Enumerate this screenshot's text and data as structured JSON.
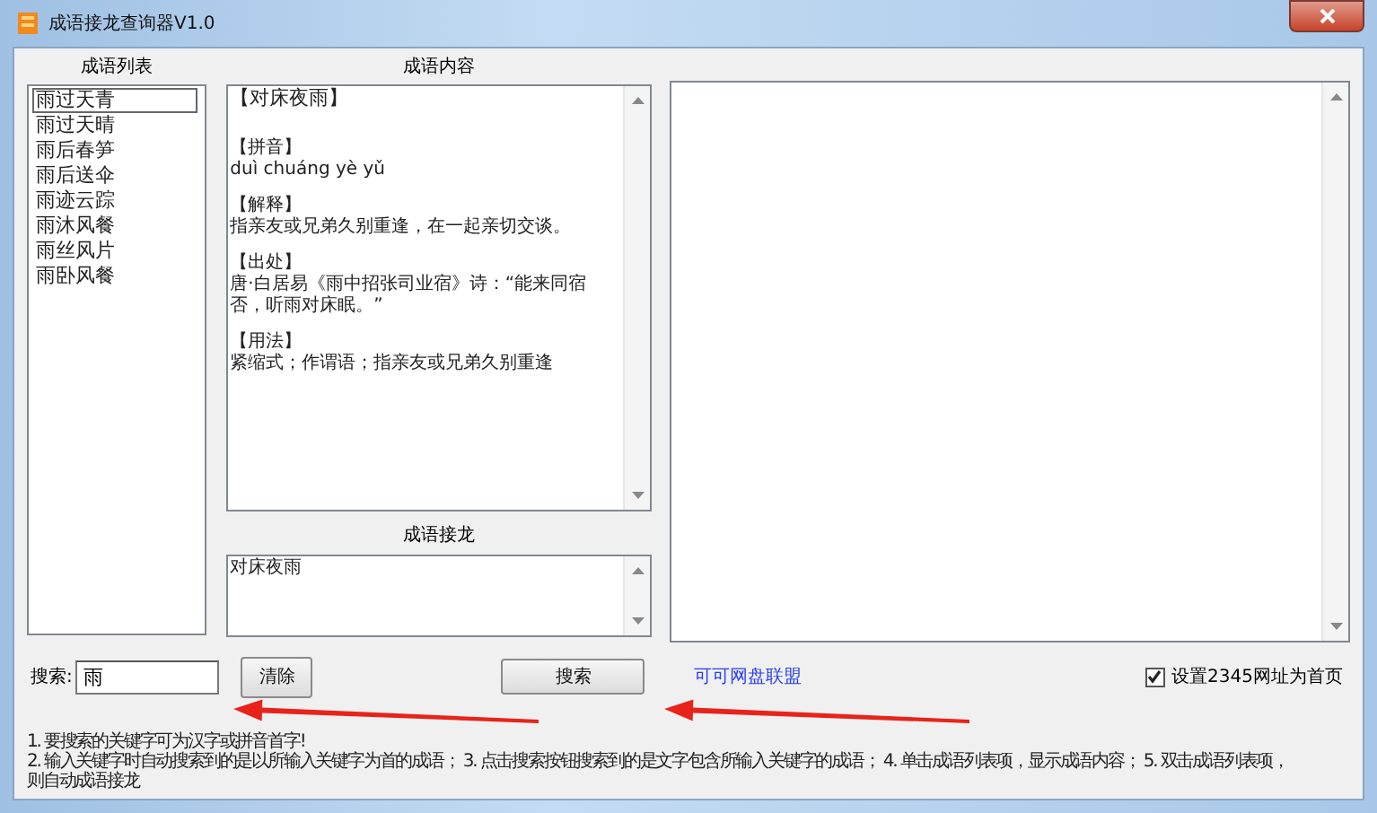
{
  "window": {
    "title": "成语接龙查询器V1.0"
  },
  "idiom_list": {
    "label": "成语列表",
    "items": [
      {
        "text": "雨过天青",
        "selected": true
      },
      {
        "text": "雨过天晴",
        "selected": false
      },
      {
        "text": "雨后春笋",
        "selected": false
      },
      {
        "text": "雨后送伞",
        "selected": false
      },
      {
        "text": "雨迹云踪",
        "selected": false
      },
      {
        "text": "雨沐风餐",
        "selected": false
      },
      {
        "text": "雨丝风片",
        "selected": false
      },
      {
        "text": "雨卧风餐",
        "selected": false
      }
    ]
  },
  "content": {
    "label": "成语内容",
    "title": "【对床夜雨】",
    "sections": [
      {
        "heading": "【拼音】",
        "text": "duì  chuáng  yè  yǔ"
      },
      {
        "heading": "【解释】",
        "text": "指亲友或兄弟久别重逢，在一起亲切交谈。"
      },
      {
        "heading": "【出处】",
        "text": "唐·白居易《雨中招张司业宿》诗：“能来同宿否，听雨对床眠。”"
      },
      {
        "heading": "【用法】",
        "text": "紧缩式；作谓语；指亲友或兄弟久别重逢"
      }
    ]
  },
  "chain": {
    "label": "成语接龙",
    "text": "对床夜雨"
  },
  "search": {
    "label": "搜索:",
    "value": "雨",
    "clear_button": "清除",
    "search_button": "搜索"
  },
  "link": "可可网盘联盟",
  "homepage_checkbox": {
    "label": "设置2345网址为首页",
    "checked": true
  },
  "help": [
    "1. 要搜索的关键字可为汉字或拼音首字!",
    "2. 输入关键字时自动搜索到的是以所输入关键字为首的成语； 3. 点击搜索按钮搜索到的是文字包含所输入关键字的成语； 4. 单击成语列表项，显示成语内容； 5. 双击成语列表项，",
    "则自动成语接龙"
  ]
}
